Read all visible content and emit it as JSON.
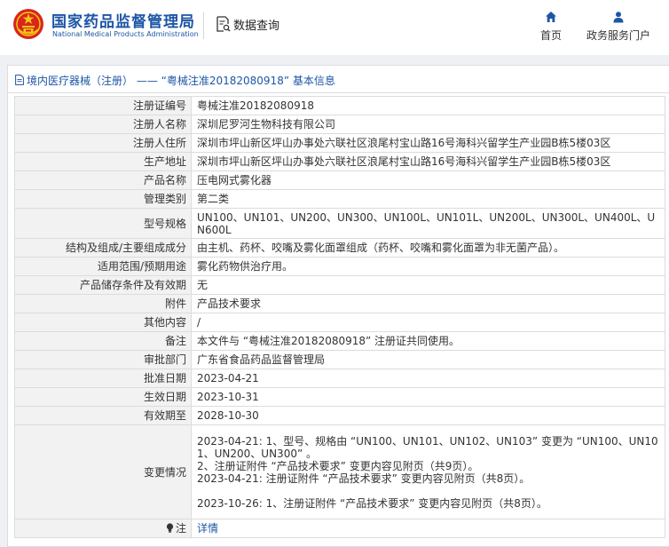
{
  "header": {
    "brand_cn": "国家药品监督管理局",
    "brand_en": "National Medical Products Administration",
    "query_label": "数据查询",
    "nav": [
      {
        "label": "首页",
        "icon": "home-icon"
      },
      {
        "label": "政务服务门户",
        "icon": "user-icon"
      }
    ]
  },
  "panel": {
    "title": "境内医疗器械（注册） —— “粤械注准20182080918” 基本信息"
  },
  "table": {
    "rows": [
      {
        "label": "注册证编号",
        "value": "粤械注准20182080918"
      },
      {
        "label": "注册人名称",
        "value": "深圳尼罗河生物科技有限公司"
      },
      {
        "label": "注册人住所",
        "value": "深圳市坪山新区坪山办事处六联社区浪尾村宝山路16号海科兴留学生产业园B栋5楼03区"
      },
      {
        "label": "生产地址",
        "value": "深圳市坪山新区坪山办事处六联社区浪尾村宝山路16号海科兴留学生产业园B栋5楼03区"
      },
      {
        "label": "产品名称",
        "value": "压电网式雾化器"
      },
      {
        "label": "管理类别",
        "value": "第二类"
      },
      {
        "label": "型号规格",
        "value": "UN100、UN101、UN200、UN300、UN100L、UN101L、UN200L、UN300L、UN400L、UN600L"
      },
      {
        "label": "结构及组成/主要组成成分",
        "value": "由主机、药杯、咬嘴及雾化面罩组成（药杯、咬嘴和雾化面罩为非无菌产品）。"
      },
      {
        "label": "适用范围/预期用途",
        "value": "雾化药物供治疗用。"
      },
      {
        "label": "产品储存条件及有效期",
        "value": "无"
      },
      {
        "label": "附件",
        "value": "产品技术要求"
      },
      {
        "label": "其他内容",
        "value": "/"
      },
      {
        "label": "备注",
        "value": "本文件与 “粤械注准20182080918” 注册证共同使用。"
      },
      {
        "label": "审批部门",
        "value": "广东省食品药品监督管理局"
      },
      {
        "label": "批准日期",
        "value": "2023-04-21"
      },
      {
        "label": "生效日期",
        "value": "2023-10-31"
      },
      {
        "label": "有效期至",
        "value": "2028-10-30"
      }
    ],
    "change": {
      "label": "变更情况",
      "lines": [
        "2023-04-21: 1、型号、规格由 “UN100、UN101、UN102、UN103” 变更为 “UN100、UN101、UN200、UN300” 。",
        "2、注册证附件 “产品技术要求” 变更内容见附页（共9页）。",
        "2023-04-21: 注册证附件 “产品技术要求” 变更内容见附页（共8页）。",
        "",
        "2023-10-26: 1、注册证附件 “产品技术要求” 变更内容见附页（共8页）。"
      ]
    },
    "note": {
      "label": "注",
      "icon": "lightbulb-icon",
      "link_text": "详情"
    }
  }
}
